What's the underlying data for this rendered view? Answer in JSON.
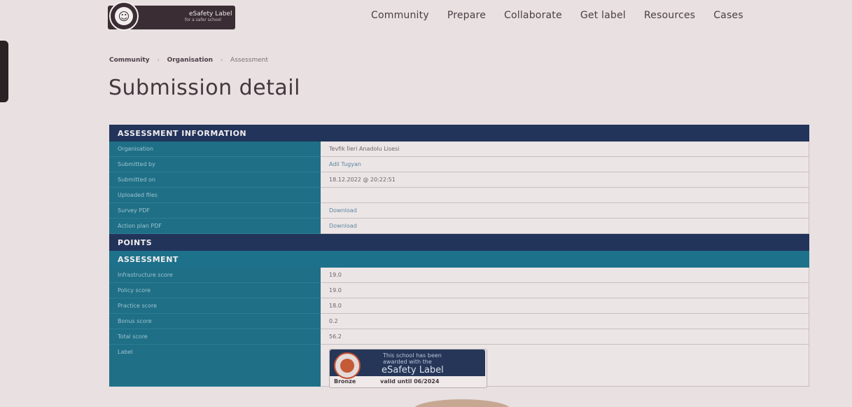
{
  "header": {
    "logo_title": "eSafety Label",
    "logo_subtitle": "for a safer school",
    "nav": [
      "Community",
      "Prepare",
      "Collaborate",
      "Get label",
      "Resources",
      "Cases"
    ]
  },
  "breadcrumb": {
    "items": [
      "Community",
      "Organisation",
      "Assessment"
    ],
    "separator": "›"
  },
  "page_title": "Submission detail",
  "assessment_information": {
    "heading": "ASSESSMENT INFORMATION",
    "rows": [
      {
        "label": "Organisation",
        "value": "Tevfik İleri Anadolu Lisesi"
      },
      {
        "label": "Submitted by",
        "value": "Adil Tugyan"
      },
      {
        "label": "Submitted on",
        "value": "18.12.2022 @ 20:22:51"
      },
      {
        "label": "Uploaded files",
        "value": ""
      },
      {
        "label": "Survey PDF",
        "value": "Download"
      },
      {
        "label": "Action plan PDF",
        "value": "Download"
      }
    ]
  },
  "points": {
    "heading": "POINTS",
    "subheading": "ASSESSMENT",
    "rows": [
      {
        "label": "Infrastructure score",
        "value": "19.0"
      },
      {
        "label": "Policy score",
        "value": "19.0"
      },
      {
        "label": "Practice score",
        "value": "18.0"
      },
      {
        "label": "Bonus score",
        "value": "0.2"
      },
      {
        "label": "Total score",
        "value": "56.2"
      }
    ],
    "label_row_label": "Label"
  },
  "badge": {
    "line1": "This school has been",
    "line2": "awarded with the",
    "title": "eSafety Label",
    "level": "Bronze",
    "valid": "valid until 06/2024"
  },
  "colors": {
    "dark_header": "#22345a",
    "teal": "#1d718a",
    "background": "#e8e0e1"
  }
}
